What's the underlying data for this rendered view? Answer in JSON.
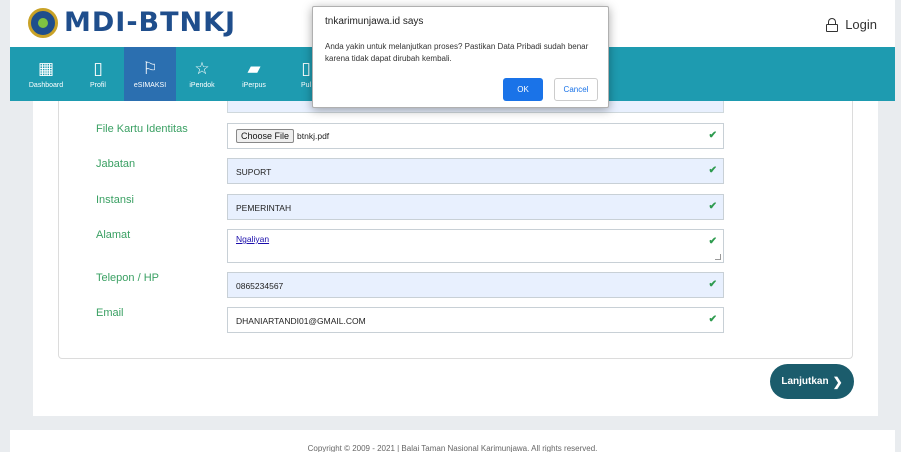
{
  "header": {
    "brand": "MDI-BTNKJ",
    "login_label": "Login"
  },
  "nav": {
    "items": [
      {
        "label": "Dashboard",
        "icon": "dashboard-icon"
      },
      {
        "label": "Profil",
        "icon": "profile-icon"
      },
      {
        "label": "eSIMAKSI",
        "icon": "signpost-icon"
      },
      {
        "label": "iPendok",
        "icon": "star-icon"
      },
      {
        "label": "iPerpus",
        "icon": "book-icon"
      },
      {
        "label": "Pul",
        "icon": "page-icon"
      }
    ]
  },
  "form": {
    "fields": [
      {
        "label": "File Kartu Identitas",
        "file_button": "Choose File",
        "value": "btnkj.pdf"
      },
      {
        "label": "Jabatan",
        "value": "SUPORT"
      },
      {
        "label": "Instansi",
        "value": "PEMERINTAH"
      },
      {
        "label": "Alamat",
        "value": "Ngaliyan"
      },
      {
        "label": "Telepon / HP",
        "value": "0865234567"
      },
      {
        "label": "Email",
        "value": "DHANIARTANDI01@GMAIL.COM"
      }
    ],
    "next_label": "Lanjutkan",
    "next_icon": "chevron-right-icon"
  },
  "footer": {
    "copyright": "Copyright © 2009 - 2021 | Balai Taman Nasional Karimunjawa. All rights reserved."
  },
  "dialog": {
    "title": "tnkarimunjawa.id says",
    "message": "Anda yakin untuk melanjutkan proses? Pastikan Data Pribadi sudah benar karena tidak dapat dirubah kembali.",
    "ok_label": "OK",
    "cancel_label": "Cancel"
  },
  "colors": {
    "nav_bg": "#1e9bb0",
    "nav_active": "#2b6fb0",
    "label_green": "#3aa063",
    "next_button": "#1b5c6c",
    "dialog_ok": "#1a73e8"
  }
}
